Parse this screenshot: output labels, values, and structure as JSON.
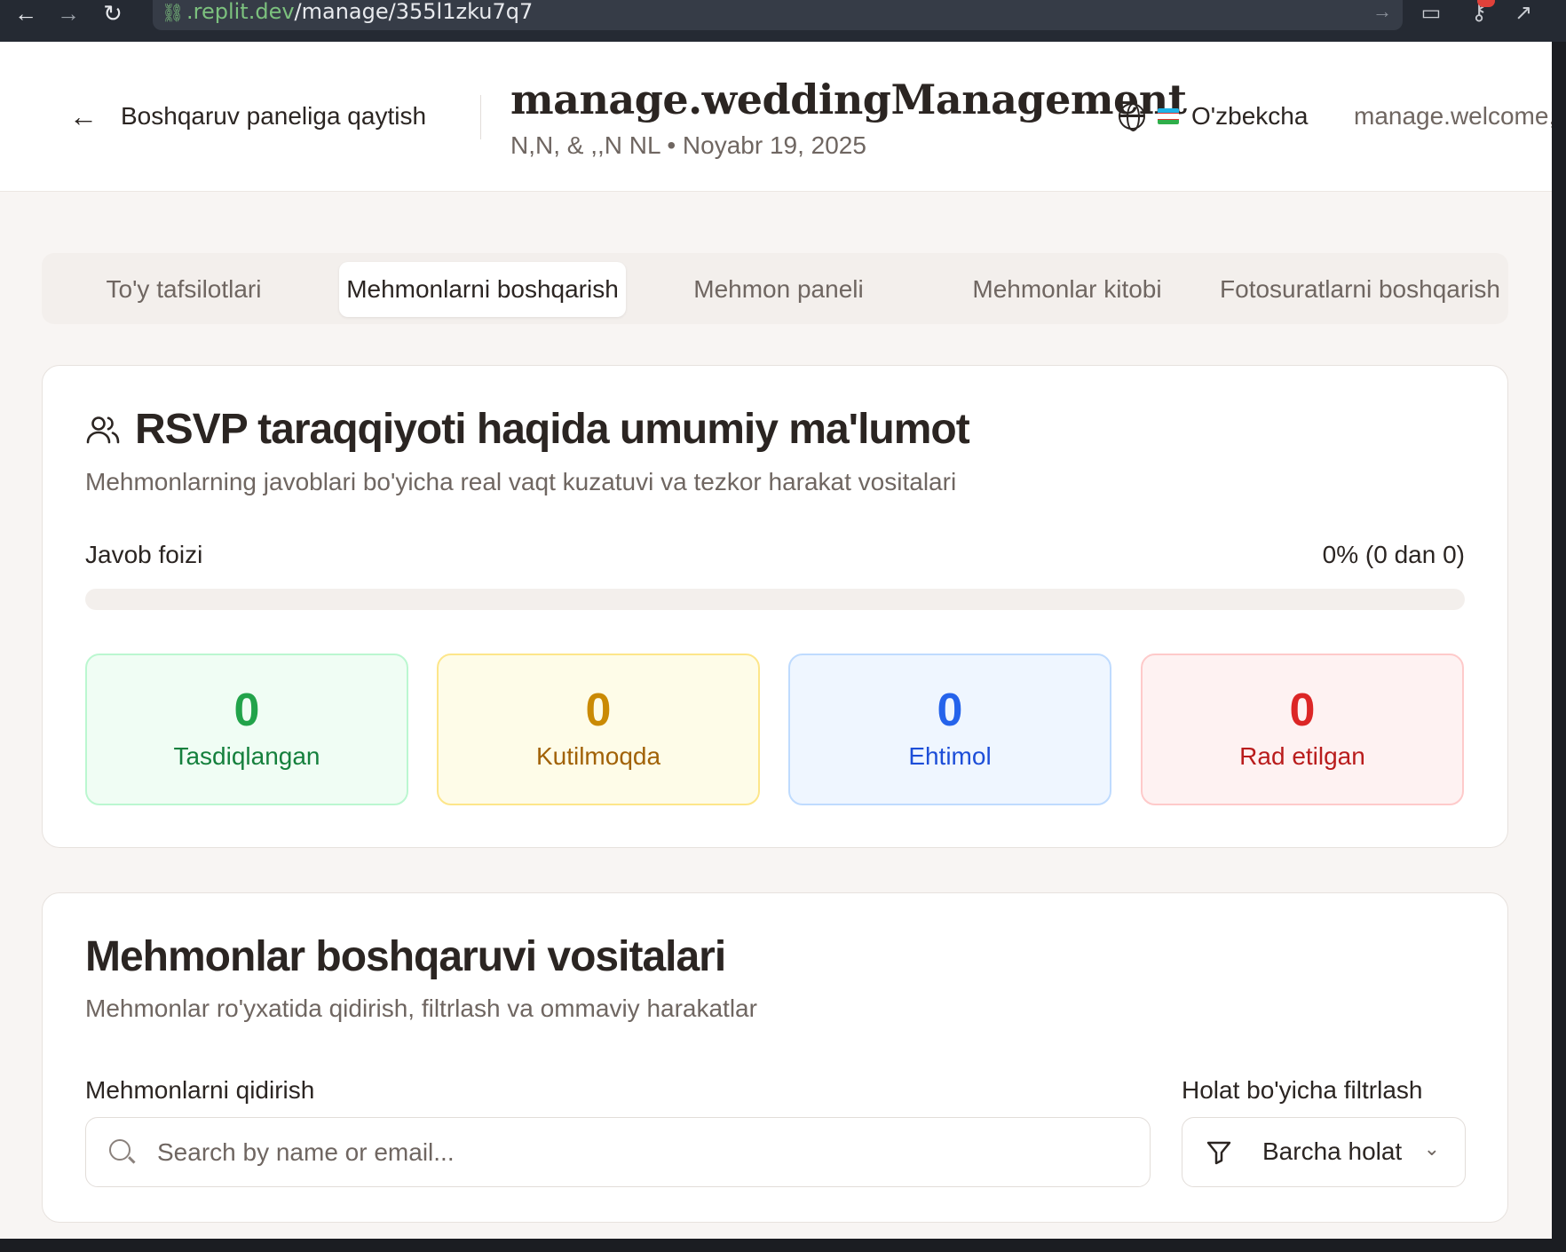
{
  "browser": {
    "url_host": ".replit.dev",
    "url_path": "/manage/355l1zku7q7"
  },
  "header": {
    "back_label": "Boshqaruv paneliga qaytish",
    "title": "manage.weddingManagement",
    "subtitle": "N,N, & ,,N NL • Noyabr 19, 2025",
    "language": "O'zbekcha",
    "welcome": "manage.welcome,"
  },
  "tabs": [
    {
      "label": "To'y tafsilotlari"
    },
    {
      "label": "Mehmonlarni boshqarish",
      "active": true
    },
    {
      "label": "Mehmon paneli"
    },
    {
      "label": "Mehmonlar kitobi"
    },
    {
      "label": "Fotosuratlarni boshqarish"
    }
  ],
  "rsvp": {
    "title": "RSVP taraqqiyoti haqida umumiy ma'lumot",
    "subtitle": "Mehmonlarning javoblari bo'yicha real vaqt kuzatuvi va tezkor harakat vositalari",
    "rate_label": "Javob foizi",
    "rate_value": "0% (0 dan 0)",
    "rate_fraction": 0,
    "stats": [
      {
        "value": "0",
        "label": "Tasdiqlangan"
      },
      {
        "value": "0",
        "label": "Kutilmoqda"
      },
      {
        "value": "0",
        "label": "Ehtimol"
      },
      {
        "value": "0",
        "label": "Rad etilgan"
      }
    ]
  },
  "tools": {
    "title": "Mehmonlar boshqaruvi vositalari",
    "subtitle": "Mehmonlar ro'yxatida qidirish, filtrlash va ommaviy harakatlar",
    "search_label": "Mehmonlarni qidirish",
    "search_placeholder": "Search by name or email...",
    "filter_label": "Holat bo'yicha filtrlash",
    "filter_value": "Barcha holat"
  },
  "icons": [
    "back-arrow-icon",
    "forward-arrow-icon",
    "reload-icon",
    "link-icon",
    "go-icon",
    "monitor-icon",
    "key-icon",
    "external-link-icon",
    "arrow-left-icon",
    "globe-icon",
    "uzbek-flag-icon",
    "users-icon",
    "search-icon",
    "filter-icon",
    "chevron-down-icon"
  ],
  "colors": {
    "confirmed": "#22a34a",
    "pending": "#ca8a04",
    "maybe": "#2563eb",
    "declined": "#dc2626"
  }
}
